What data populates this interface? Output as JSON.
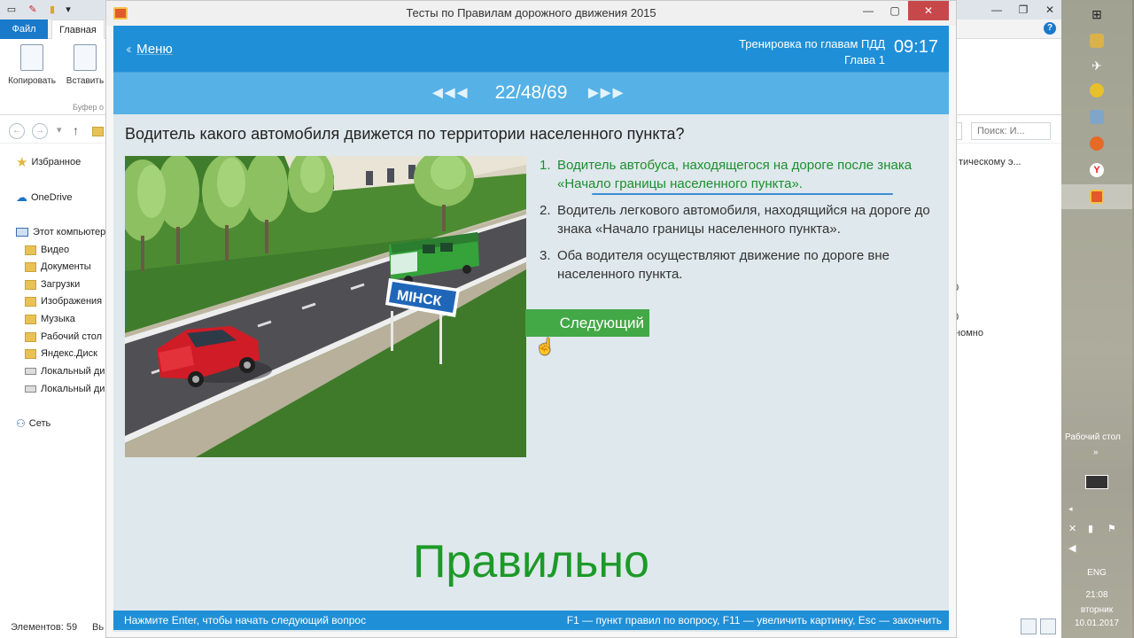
{
  "explorer": {
    "tab_file": "Файл",
    "tab_home": "Главная",
    "ribbon_copy": "Копировать",
    "ribbon_paste": "Вставить",
    "ribbon_group": "Буфер о",
    "search_placeholder": "Поиск: И...",
    "favorites": "Избранное",
    "sidebar": [
      {
        "label": "OneDrive",
        "icon": "cloud-icon"
      },
      {
        "label": "Этот компьютер",
        "icon": "computer-icon"
      },
      {
        "label": "Видео",
        "icon": "folder-icon"
      },
      {
        "label": "Документы",
        "icon": "folder-icon"
      },
      {
        "label": "Загрузки",
        "icon": "folder-icon"
      },
      {
        "label": "Изображения",
        "icon": "folder-icon"
      },
      {
        "label": "Музыка",
        "icon": "folder-icon"
      },
      {
        "label": "Рабочий стол",
        "icon": "folder-icon"
      },
      {
        "label": "Яндекс.Диск",
        "icon": "folder-icon"
      },
      {
        "label": "Локальный ди",
        "icon": "drive-icon"
      },
      {
        "label": "Локальный ди",
        "icon": "drive-icon"
      },
      {
        "label": "Сеть",
        "icon": "network-icon"
      }
    ],
    "right_text_1": "тическому э...",
    "right_text_2": "номно",
    "status_items": "Элементов: 59",
    "status_selected": "Вь"
  },
  "tray": {
    "desktop_label": "Рабочий стол",
    "lang": "ENG",
    "time": "21:08",
    "weekday": "вторник",
    "date": "10.01.2017"
  },
  "app": {
    "title": "Тесты по Правилам дорожного движения 2015",
    "menu_label": "Меню",
    "header_title": "Тренировка по главам ПДД",
    "header_chapter": "Глава 1",
    "timer": "09:17",
    "counter": "22/48/69",
    "question": "Водитель какого автомобиля движется по территории населенного пункта?",
    "sign_text": "МІНСК",
    "answers": [
      {
        "num": "1.",
        "text": "Водитель автобуса, находящегося на дороге после знака «Начало границы населенного пункта».",
        "correct": true
      },
      {
        "num": "2.",
        "text": "Водитель легкового автомобиля, находящийся на дороге до знака «Начало границы населенного пункта».",
        "correct": false
      },
      {
        "num": "3.",
        "text": "Оба водителя осуществляют движение по дороге вне населенного пункта.",
        "correct": false
      }
    ],
    "next_button": "Следующий",
    "result": "Правильно",
    "footer_left": "Нажмите Enter, чтобы начать следующий вопрос",
    "footer_right": "F1 — пункт правил по вопросу, F11 — увеличить картинку, Esc — закончить",
    "colors": {
      "header_blue": "#1f8fd7",
      "nav_blue": "#55b1e6",
      "correct_green": "#1c8f2f",
      "button_green": "#43a846",
      "close_red": "#c7484a"
    }
  }
}
